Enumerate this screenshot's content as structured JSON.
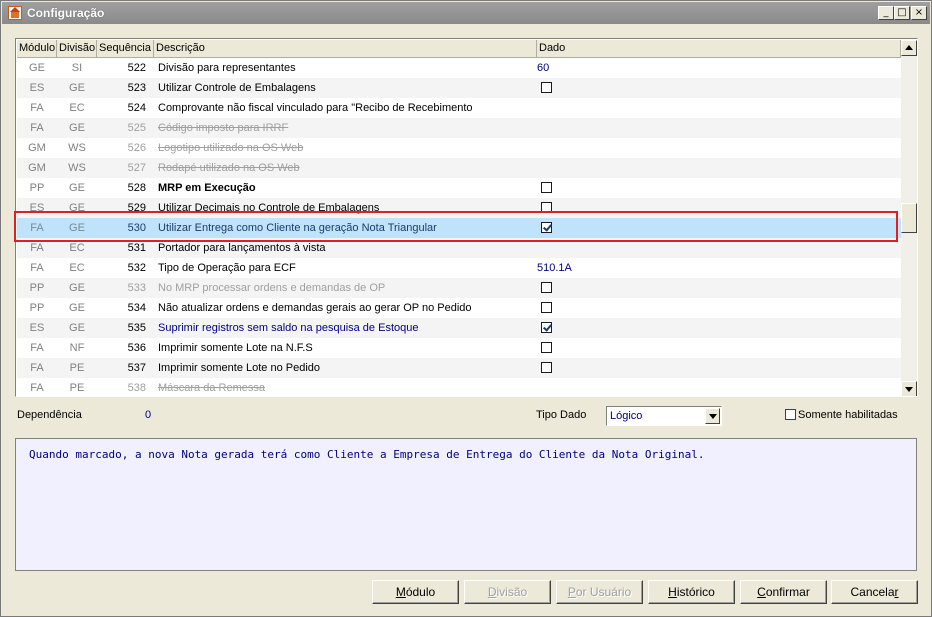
{
  "window": {
    "title": "Configuração"
  },
  "columns": {
    "modulo": "Módulo",
    "divisao": "Divisão",
    "sequencia": "Sequência",
    "descricao": "Descrição",
    "dado": "Dado"
  },
  "rows": [
    {
      "modulo": "GE",
      "divisao": "SI",
      "sequencia": "522",
      "descricao": "Divisão para representantes",
      "dado": "60",
      "dado_type": "text",
      "style": ""
    },
    {
      "modulo": "ES",
      "divisao": "GE",
      "sequencia": "523",
      "descricao": "Utilizar Controle de Embalagens",
      "dado": "",
      "dado_type": "check_off",
      "style": ""
    },
    {
      "modulo": "FA",
      "divisao": "EC",
      "sequencia": "524",
      "descricao": "Comprovante não fiscal vinculado para \"Recibo de Recebimento",
      "dado": "",
      "dado_type": "none",
      "style": ""
    },
    {
      "modulo": "FA",
      "divisao": "GE",
      "sequencia": "525",
      "descricao": "Código imposto para IRRF",
      "dado": "",
      "dado_type": "none",
      "style": "strike disabled"
    },
    {
      "modulo": "GM",
      "divisao": "WS",
      "sequencia": "526",
      "descricao": "Logotipo utilizado na OS Web",
      "dado": "",
      "dado_type": "none",
      "style": "strike disabled"
    },
    {
      "modulo": "GM",
      "divisao": "WS",
      "sequencia": "527",
      "descricao": "Rodapé utilizado na OS Web",
      "dado": "",
      "dado_type": "none",
      "style": "strike disabled"
    },
    {
      "modulo": "PP",
      "divisao": "GE",
      "sequencia": "528",
      "descricao": "MRP em Execução",
      "dado": "",
      "dado_type": "check_off",
      "style": "bold"
    },
    {
      "modulo": "ES",
      "divisao": "GE",
      "sequencia": "529",
      "descricao": "Utilizar Decimais no Controle de Embalagens",
      "dado": "",
      "dado_type": "check_off",
      "style": ""
    },
    {
      "modulo": "FA",
      "divisao": "GE",
      "sequencia": "530",
      "descricao": "Utilizar Entrega como Cliente na geração Nota Triangular",
      "dado": "",
      "dado_type": "check_on",
      "style": "selected"
    },
    {
      "modulo": "FA",
      "divisao": "EC",
      "sequencia": "531",
      "descricao": "Portador para lançamentos à vista",
      "dado": "",
      "dado_type": "none",
      "style": ""
    },
    {
      "modulo": "FA",
      "divisao": "EC",
      "sequencia": "532",
      "descricao": "Tipo de Operação para ECF",
      "dado": "510.1A",
      "dado_type": "text",
      "style": ""
    },
    {
      "modulo": "PP",
      "divisao": "GE",
      "sequencia": "533",
      "descricao": "No MRP processar ordens e demandas de OP",
      "dado": "",
      "dado_type": "check_off",
      "style": "disabled"
    },
    {
      "modulo": "PP",
      "divisao": "GE",
      "sequencia": "534",
      "descricao": "Não atualizar ordens e demandas gerais ao gerar OP no Pedido",
      "dado": "",
      "dado_type": "check_off",
      "style": ""
    },
    {
      "modulo": "ES",
      "divisao": "GE",
      "sequencia": "535",
      "descricao": "Suprimir registros sem saldo na pesquisa de Estoque",
      "dado": "",
      "dado_type": "check_on",
      "style": "blue"
    },
    {
      "modulo": "FA",
      "divisao": "NF",
      "sequencia": "536",
      "descricao": "Imprimir somente Lote na N.F.S",
      "dado": "",
      "dado_type": "check_off",
      "style": ""
    },
    {
      "modulo": "FA",
      "divisao": "PE",
      "sequencia": "537",
      "descricao": "Imprimir somente Lote no Pedido",
      "dado": "",
      "dado_type": "check_off",
      "style": ""
    },
    {
      "modulo": "FA",
      "divisao": "PE",
      "sequencia": "538",
      "descricao": "Máscara da Remessa",
      "dado": "",
      "dado_type": "none",
      "style": "strike disabled"
    }
  ],
  "footer": {
    "dependencia_label": "Dependência",
    "dependencia_value": "0",
    "tipo_dado_label": "Tipo Dado",
    "tipo_dado_value": "Lógico",
    "somente_label": "Somente habilitadas",
    "description": "Quando marcado, a nova Nota gerada terá como Cliente a Empresa de Entrega do Cliente da Nota Original."
  },
  "buttons": {
    "modulo": {
      "pre": "",
      "u": "M",
      "post": "ódulo"
    },
    "divisao": {
      "pre": "",
      "u": "D",
      "post": "ivisão"
    },
    "por_usuario": {
      "pre": "",
      "u": "P",
      "post": "or Usuário"
    },
    "historico": {
      "pre": "",
      "u": "H",
      "post": "istórico"
    },
    "confirmar": {
      "pre": "",
      "u": "C",
      "post": "onfirmar"
    },
    "cancelar": {
      "pre": "Cancela",
      "u": "r",
      "post": ""
    }
  },
  "icons": {
    "app": "app-home-icon",
    "minimize": "minimize-icon",
    "maximize": "maximize-icon",
    "close": "close-icon"
  }
}
